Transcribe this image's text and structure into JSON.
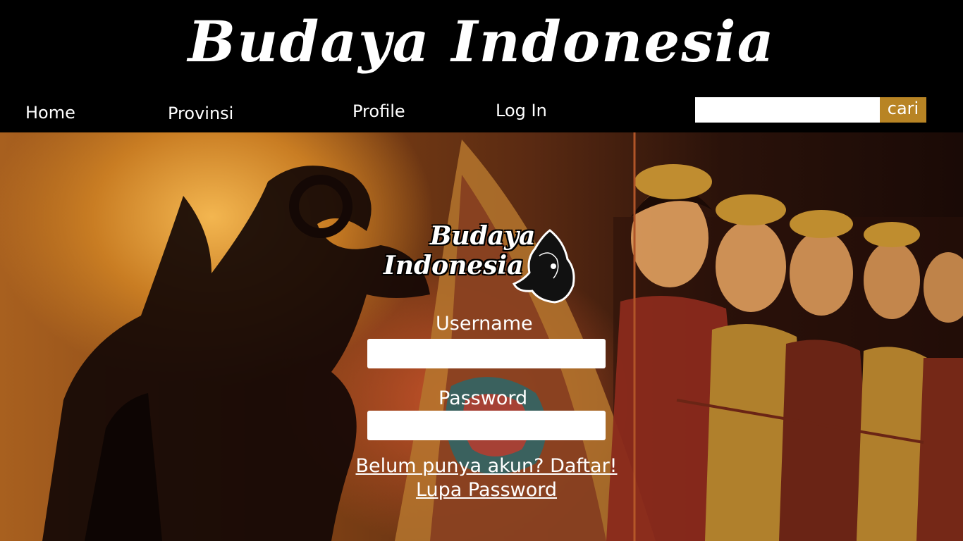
{
  "header": {
    "site_title": "Budaya Indonesia",
    "nav": {
      "home": "Home",
      "provinsi": "Provinsi",
      "profile": "Profile",
      "login": "Log In"
    },
    "search": {
      "value": "",
      "button_label": "cari"
    }
  },
  "login_form": {
    "logo": {
      "line1": "Budaya",
      "line2": "Indonesia",
      "icon": "wayang-kulit-icon"
    },
    "username_label": "Username",
    "username_value": "",
    "password_label": "Password",
    "password_value": "",
    "register_link": "Belum punya akun? Daftar!",
    "forgot_link": "Lupa Password"
  },
  "colors": {
    "header_bg": "#000000",
    "accent": "#b88424",
    "text": "#ffffff"
  }
}
